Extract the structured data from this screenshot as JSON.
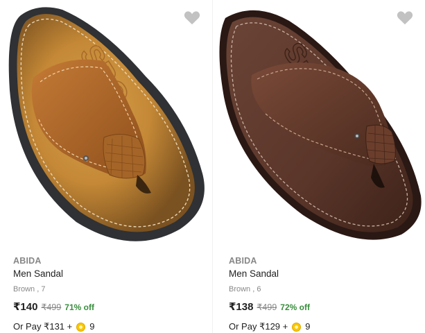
{
  "colors": {
    "discount_green": "#388e3c",
    "muted_gray": "#878787",
    "heart_gray": "#c2c2c2",
    "coin_yellow": "#f9c700"
  },
  "products": [
    {
      "brand": "ABIDA",
      "title": "Men Sandal",
      "variant": "Brown , 7",
      "price": "₹140",
      "mrp": "₹499",
      "discount": "71% off",
      "pay_prefix": "Or Pay ₹131 +",
      "coins": "9",
      "wishlist_icon": "heart-icon",
      "coin_icon": "supercoin-icon"
    },
    {
      "brand": "ABIDA",
      "title": "Men Sandal",
      "variant": "Brown , 6",
      "price": "₹138",
      "mrp": "₹499",
      "discount": "72% off",
      "pay_prefix": "Or Pay ₹129 +",
      "coins": "9",
      "wishlist_icon": "heart-icon",
      "coin_icon": "supercoin-icon"
    }
  ]
}
